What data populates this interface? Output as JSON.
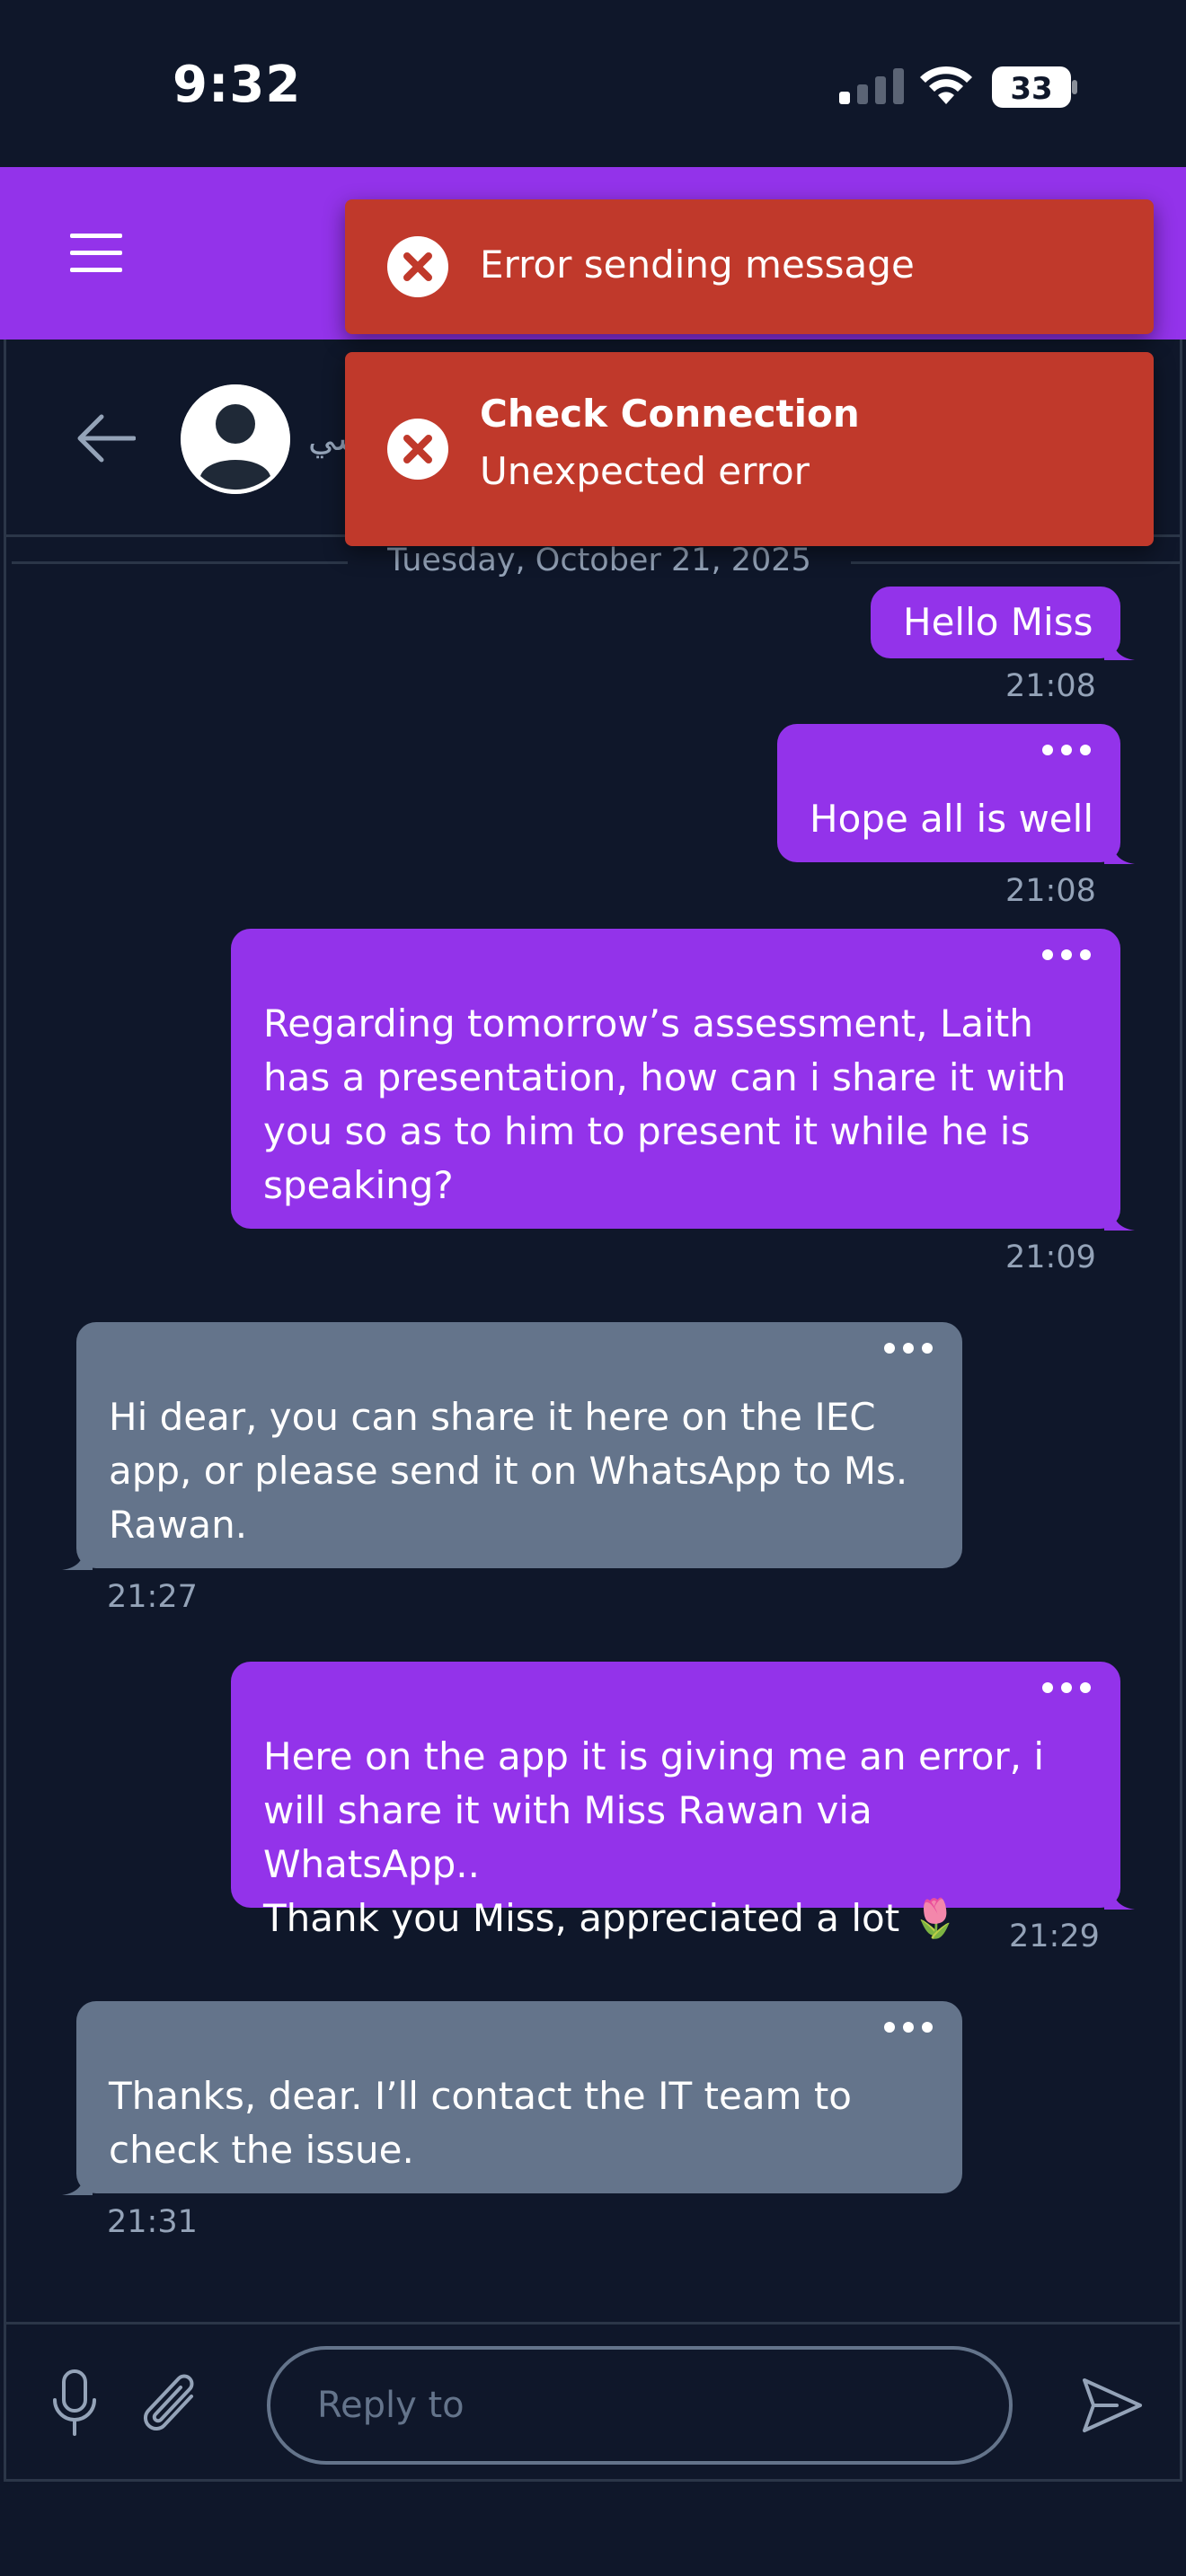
{
  "status_bar": {
    "time": "9:32",
    "battery": "33"
  },
  "contact": {
    "name": "سي"
  },
  "date_separator": "Tuesday, October 21, 2025",
  "messages": [
    {
      "direction": "out",
      "text": "Hello Miss",
      "time": "21:08"
    },
    {
      "direction": "out",
      "text": "Hope all is well",
      "time": "21:08"
    },
    {
      "direction": "out",
      "lines": [
        "Regarding tomorrow’s assessment, Laith",
        "has a presentation, how can i share it with",
        "you so as to him to present it while he is",
        "speaking?"
      ],
      "time": "21:09"
    },
    {
      "direction": "in",
      "lines": [
        "Hi dear, you can share it here on the IEC",
        "app, or please send it on WhatsApp to Ms.",
        "Rawan."
      ],
      "time": "21:27"
    },
    {
      "direction": "out",
      "lines": [
        "Here on the app it is giving me an error, i",
        "will share it with Miss Rawan via WhatsApp..",
        "Thank you Miss, appreciated a lot 🌷"
      ],
      "time": "21:29"
    },
    {
      "direction": "in",
      "lines": [
        "Thanks, dear. I’ll contact the IT team to",
        "check the issue."
      ],
      "time": "21:31"
    }
  ],
  "input": {
    "placeholder": "Reply to",
    "value": ""
  },
  "toasts": [
    {
      "type": "error",
      "text": "Error sending message"
    },
    {
      "type": "error",
      "title": "Check Connection",
      "text": "Unexpected error"
    }
  ],
  "colors": {
    "background": "#0f172a",
    "header": "#9333ea",
    "outgoing_bubble": "#9333ea",
    "incoming_bubble": "#64748b",
    "toast_error": "#c0392b"
  },
  "icons": [
    "menu-icon",
    "back-icon",
    "avatar-icon",
    "more-dots-icon",
    "mic-icon",
    "paperclip-icon",
    "send-icon",
    "error-icon",
    "signal-icon",
    "wifi-icon",
    "battery-icon"
  ]
}
